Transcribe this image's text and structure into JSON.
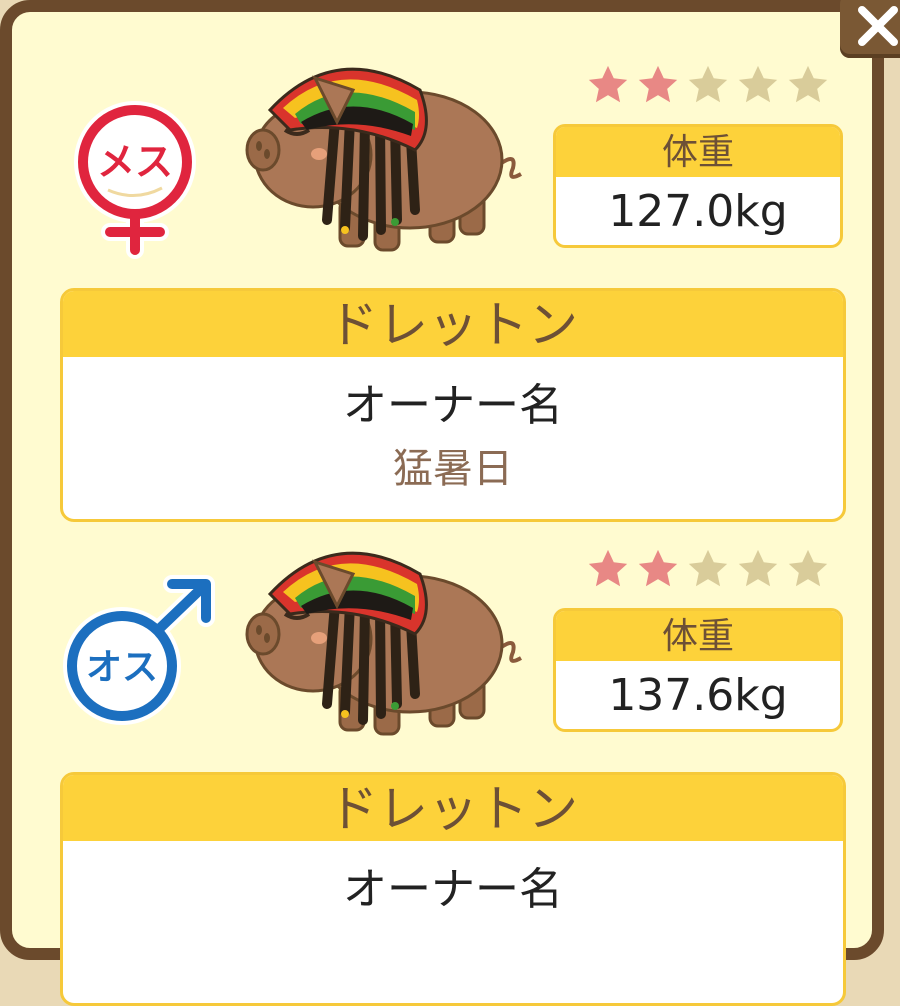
{
  "colors": {
    "frame": "#6b4a2c",
    "panel_bg": "#fffbd0",
    "header_yellow": "#fdd23a",
    "star_filled": "#e88885",
    "star_empty": "#d9cc9a",
    "female": "#e0253e",
    "male": "#1c6fbf"
  },
  "close_button": {
    "icon": "close-x-icon"
  },
  "entries": [
    {
      "gender": {
        "icon": "female-symbol-icon",
        "label": "メス"
      },
      "pig_icon": "rasta-pig-icon",
      "rating": {
        "filled": 2,
        "max": 5
      },
      "weight": {
        "label": "体重",
        "value": "127.0kg"
      },
      "breed": "ドレットン",
      "owner_label": "オーナー名",
      "owner_name": "猛暑日"
    },
    {
      "gender": {
        "icon": "male-symbol-icon",
        "label": "オス"
      },
      "pig_icon": "rasta-pig-icon",
      "rating": {
        "filled": 2,
        "max": 5
      },
      "weight": {
        "label": "体重",
        "value": "137.6kg"
      },
      "breed": "ドレットン",
      "owner_label": "オーナー名",
      "owner_name": ""
    }
  ]
}
